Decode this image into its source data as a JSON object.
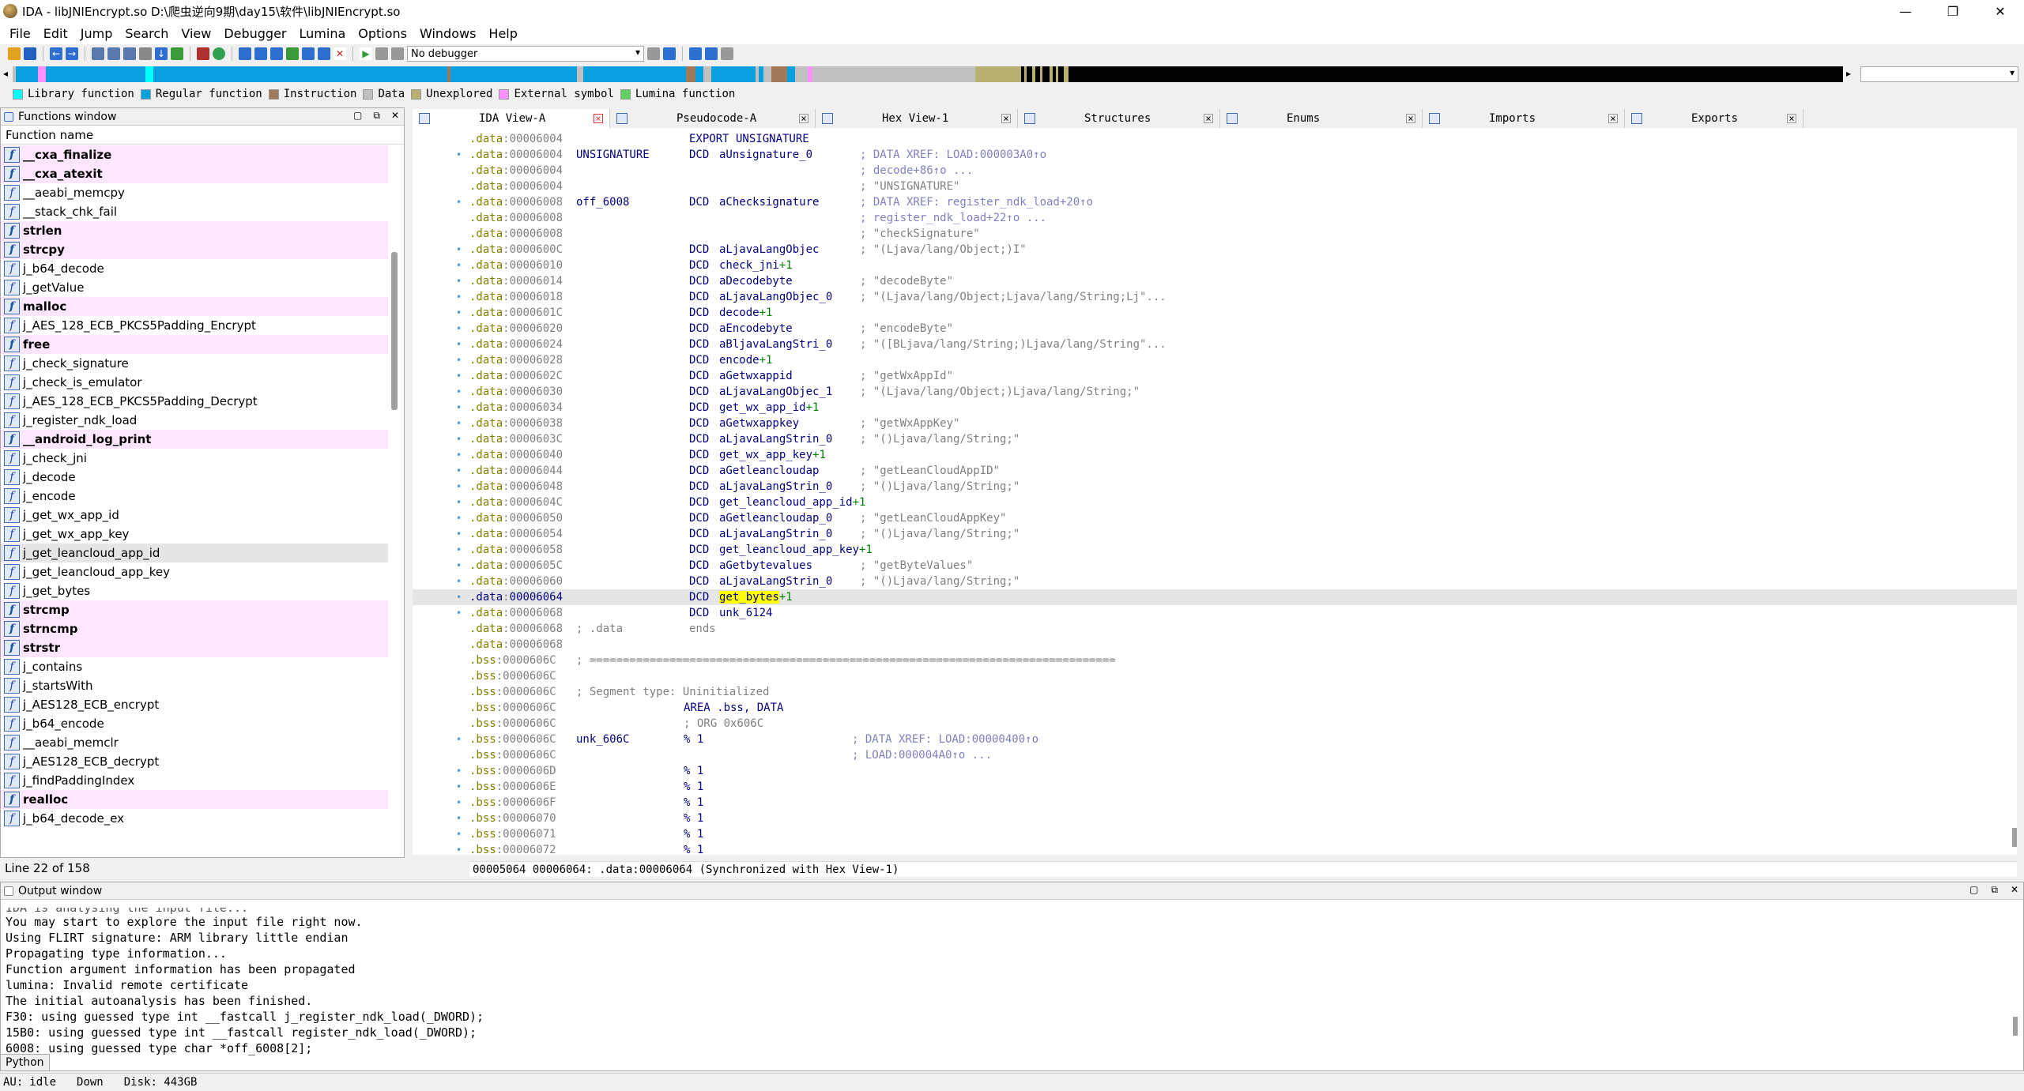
{
  "window": {
    "title": "IDA - libJNIEncrypt.so D:\\爬虫逆向9期\\day15\\软件\\libJNIEncrypt.so",
    "min_icon": "minimize-icon",
    "max_icon": "maximize-icon",
    "close_icon": "close-icon"
  },
  "menu": [
    "File",
    "Edit",
    "Jump",
    "Search",
    "View",
    "Debugger",
    "Lumina",
    "Options",
    "Windows",
    "Help"
  ],
  "toolbar": {
    "debugger_label": "No debugger"
  },
  "legend": [
    {
      "label": "Library function",
      "color": "#00ffff"
    },
    {
      "label": "Regular function",
      "color": "#0aa0e0"
    },
    {
      "label": "Instruction",
      "color": "#a0785a"
    },
    {
      "label": "Data",
      "color": "#c0c0c0"
    },
    {
      "label": "Unexplored",
      "color": "#b8b070"
    },
    {
      "label": "External symbol",
      "color": "#ff90ff"
    },
    {
      "label": "Lumina function",
      "color": "#60d060"
    }
  ],
  "functions_window": {
    "title": "Functions window",
    "column": "Function name",
    "items": [
      {
        "name": "__cxa_finalize",
        "lib": true
      },
      {
        "name": "__cxa_atexit",
        "lib": true
      },
      {
        "name": "__aeabi_memcpy",
        "lib": false
      },
      {
        "name": "__stack_chk_fail",
        "lib": false
      },
      {
        "name": "strlen",
        "lib": true
      },
      {
        "name": "strcpy",
        "lib": true
      },
      {
        "name": "j_b64_decode",
        "lib": false
      },
      {
        "name": "j_getValue",
        "lib": false
      },
      {
        "name": "malloc",
        "lib": true
      },
      {
        "name": "j_AES_128_ECB_PKCS5Padding_Encrypt",
        "lib": false
      },
      {
        "name": "free",
        "lib": true
      },
      {
        "name": "j_check_signature",
        "lib": false
      },
      {
        "name": "j_check_is_emulator",
        "lib": false
      },
      {
        "name": "j_AES_128_ECB_PKCS5Padding_Decrypt",
        "lib": false
      },
      {
        "name": "j_register_ndk_load",
        "lib": false
      },
      {
        "name": "__android_log_print",
        "lib": true
      },
      {
        "name": "j_check_jni",
        "lib": false
      },
      {
        "name": "j_decode",
        "lib": false
      },
      {
        "name": "j_encode",
        "lib": false
      },
      {
        "name": "j_get_wx_app_id",
        "lib": false
      },
      {
        "name": "j_get_wx_app_key",
        "lib": false
      },
      {
        "name": "j_get_leancloud_app_id",
        "lib": false,
        "selected": true
      },
      {
        "name": "j_get_leancloud_app_key",
        "lib": false
      },
      {
        "name": "j_get_bytes",
        "lib": false
      },
      {
        "name": "strcmp",
        "lib": true
      },
      {
        "name": "strncmp",
        "lib": true
      },
      {
        "name": "strstr",
        "lib": true
      },
      {
        "name": "j_contains",
        "lib": false
      },
      {
        "name": "j_startsWith",
        "lib": false
      },
      {
        "name": "j_AES128_ECB_encrypt",
        "lib": false
      },
      {
        "name": "j_b64_encode",
        "lib": false
      },
      {
        "name": "__aeabi_memclr",
        "lib": false
      },
      {
        "name": "j_AES128_ECB_decrypt",
        "lib": false
      },
      {
        "name": "j_findPaddingIndex",
        "lib": false
      },
      {
        "name": "realloc",
        "lib": true
      },
      {
        "name": "j_b64_decode_ex",
        "lib": false
      }
    ],
    "status": "Line 22 of 158"
  },
  "tabs": [
    {
      "label": "IDA View-A",
      "active": true
    },
    {
      "label": "Pseudocode-A",
      "active": false
    },
    {
      "label": "Hex View-1",
      "active": false
    },
    {
      "label": "Structures",
      "active": false
    },
    {
      "label": "Enums",
      "active": false
    },
    {
      "label": "Imports",
      "active": false
    },
    {
      "label": "Exports",
      "active": false
    }
  ],
  "disasm": [
    {
      "seg": ".data",
      "addr": "00006004",
      "dot": false,
      "label": "",
      "mn": "",
      "op": "EXPORT UNSIGNATURE",
      "cm": ""
    },
    {
      "seg": ".data",
      "addr": "00006004",
      "dot": true,
      "label": "UNSIGNATURE",
      "mn": "DCD",
      "op": "aUnsignature_0",
      "cm": "; DATA XREF: LOAD:000003A0↑o"
    },
    {
      "seg": ".data",
      "addr": "00006004",
      "dot": false,
      "label": "",
      "mn": "",
      "op": "",
      "cm": "; decode+86↑o ..."
    },
    {
      "seg": ".data",
      "addr": "00006004",
      "dot": false,
      "label": "",
      "mn": "",
      "op": "",
      "cm": "; \"UNSIGNATURE\""
    },
    {
      "seg": ".data",
      "addr": "00006008",
      "dot": true,
      "label": "off_6008",
      "mn": "DCD",
      "op": "aChecksignature",
      "cm": "; DATA XREF: register_ndk_load+20↑o"
    },
    {
      "seg": ".data",
      "addr": "00006008",
      "dot": false,
      "label": "",
      "mn": "",
      "op": "",
      "cm": "; register_ndk_load+22↑o ..."
    },
    {
      "seg": ".data",
      "addr": "00006008",
      "dot": false,
      "label": "",
      "mn": "",
      "op": "",
      "cm": "; \"checkSignature\""
    },
    {
      "seg": ".data",
      "addr": "0000600C",
      "dot": true,
      "label": "",
      "mn": "DCD",
      "op": "aLjavaLangObjec",
      "cm": "; \"(Ljava/lang/Object;)I\""
    },
    {
      "seg": ".data",
      "addr": "00006010",
      "dot": true,
      "label": "",
      "mn": "DCD",
      "op": "check_jni+1",
      "cm": ""
    },
    {
      "seg": ".data",
      "addr": "00006014",
      "dot": true,
      "label": "",
      "mn": "DCD",
      "op": "aDecodebyte",
      "cm": "; \"decodeByte\""
    },
    {
      "seg": ".data",
      "addr": "00006018",
      "dot": true,
      "label": "",
      "mn": "DCD",
      "op": "aLjavaLangObjec_0",
      "cm": "; \"(Ljava/lang/Object;Ljava/lang/String;Lj\"..."
    },
    {
      "seg": ".data",
      "addr": "0000601C",
      "dot": true,
      "label": "",
      "mn": "DCD",
      "op": "decode+1",
      "cm": ""
    },
    {
      "seg": ".data",
      "addr": "00006020",
      "dot": true,
      "label": "",
      "mn": "DCD",
      "op": "aEncodebyte",
      "cm": "; \"encodeByte\""
    },
    {
      "seg": ".data",
      "addr": "00006024",
      "dot": true,
      "label": "",
      "mn": "DCD",
      "op": "aBljavaLangStri_0",
      "cm": "; \"([BLjava/lang/String;)Ljava/lang/String\"..."
    },
    {
      "seg": ".data",
      "addr": "00006028",
      "dot": true,
      "label": "",
      "mn": "DCD",
      "op": "encode+1",
      "cm": ""
    },
    {
      "seg": ".data",
      "addr": "0000602C",
      "dot": true,
      "label": "",
      "mn": "DCD",
      "op": "aGetwxappid",
      "cm": "; \"getWxAppId\""
    },
    {
      "seg": ".data",
      "addr": "00006030",
      "dot": true,
      "label": "",
      "mn": "DCD",
      "op": "aLjavaLangObjec_1",
      "cm": "; \"(Ljava/lang/Object;)Ljava/lang/String;\""
    },
    {
      "seg": ".data",
      "addr": "00006034",
      "dot": true,
      "label": "",
      "mn": "DCD",
      "op": "get_wx_app_id+1",
      "cm": ""
    },
    {
      "seg": ".data",
      "addr": "00006038",
      "dot": true,
      "label": "",
      "mn": "DCD",
      "op": "aGetwxappkey",
      "cm": "; \"getWxAppKey\""
    },
    {
      "seg": ".data",
      "addr": "0000603C",
      "dot": true,
      "label": "",
      "mn": "DCD",
      "op": "aLjavaLangStrin_0",
      "cm": "; \"()Ljava/lang/String;\""
    },
    {
      "seg": ".data",
      "addr": "00006040",
      "dot": true,
      "label": "",
      "mn": "DCD",
      "op": "get_wx_app_key+1",
      "cm": ""
    },
    {
      "seg": ".data",
      "addr": "00006044",
      "dot": true,
      "label": "",
      "mn": "DCD",
      "op": "aGetleancloudap",
      "cm": "; \"getLeanCloudAppID\""
    },
    {
      "seg": ".data",
      "addr": "00006048",
      "dot": true,
      "label": "",
      "mn": "DCD",
      "op": "aLjavaLangStrin_0",
      "cm": "; \"()Ljava/lang/String;\""
    },
    {
      "seg": ".data",
      "addr": "0000604C",
      "dot": true,
      "label": "",
      "mn": "DCD",
      "op": "get_leancloud_app_id+1",
      "cm": ""
    },
    {
      "seg": ".data",
      "addr": "00006050",
      "dot": true,
      "label": "",
      "mn": "DCD",
      "op": "aGetleancloudap_0",
      "cm": "; \"getLeanCloudAppKey\""
    },
    {
      "seg": ".data",
      "addr": "00006054",
      "dot": true,
      "label": "",
      "mn": "DCD",
      "op": "aLjavaLangStrin_0",
      "cm": "; \"()Ljava/lang/String;\""
    },
    {
      "seg": ".data",
      "addr": "00006058",
      "dot": true,
      "label": "",
      "mn": "DCD",
      "op": "get_leancloud_app_key+1",
      "cm": ""
    },
    {
      "seg": ".data",
      "addr": "0000605C",
      "dot": true,
      "label": "",
      "mn": "DCD",
      "op": "aGetbytevalues",
      "cm": "; \"getByteValues\""
    },
    {
      "seg": ".data",
      "addr": "00006060",
      "dot": true,
      "label": "",
      "mn": "DCD",
      "op": "aLjavaLangStrin_0",
      "cm": "; \"()Ljava/lang/String;\""
    },
    {
      "seg": ".data",
      "addr": "00006064",
      "dot": true,
      "label": "",
      "mn": "DCD",
      "op": "get_bytes+1",
      "cm": "",
      "hl": true
    },
    {
      "seg": ".data",
      "addr": "00006068",
      "dot": true,
      "label": "",
      "mn": "DCD",
      "op": "unk_6124",
      "cm": ""
    },
    {
      "seg": ".data",
      "addr": "00006068",
      "dot": false,
      "label": "; .data",
      "mn": "",
      "op": "ends",
      "cm": ""
    },
    {
      "seg": ".data",
      "addr": "00006068",
      "dot": false,
      "label": "",
      "mn": "",
      "op": "",
      "cm": ""
    },
    {
      "seg": ".bss",
      "addr": "0000606C",
      "dot": false,
      "label": "; ===============================================================================",
      "mn": "",
      "op": "",
      "cm": ""
    },
    {
      "seg": ".bss",
      "addr": "0000606C",
      "dot": false,
      "label": "",
      "mn": "",
      "op": "",
      "cm": ""
    },
    {
      "seg": ".bss",
      "addr": "0000606C",
      "dot": false,
      "label": "; Segment type: Uninitialized",
      "mn": "",
      "op": "",
      "cm": ""
    },
    {
      "seg": ".bss",
      "addr": "0000606C",
      "dot": false,
      "label": "",
      "mn": "",
      "op": "AREA .bss, DATA",
      "cm": ""
    },
    {
      "seg": ".bss",
      "addr": "0000606C",
      "dot": false,
      "label": "",
      "mn": "",
      "op": "; ORG 0x606C",
      "cm": ""
    },
    {
      "seg": ".bss",
      "addr": "0000606C",
      "dot": true,
      "label": "unk_606C",
      "mn": "",
      "op": "% 1",
      "cm": "; DATA XREF: LOAD:00000400↑o"
    },
    {
      "seg": ".bss",
      "addr": "0000606C",
      "dot": false,
      "label": "",
      "mn": "",
      "op": "",
      "cm": "; LOAD:000004A0↑o ..."
    },
    {
      "seg": ".bss",
      "addr": "0000606D",
      "dot": true,
      "label": "",
      "mn": "",
      "op": "% 1",
      "cm": ""
    },
    {
      "seg": ".bss",
      "addr": "0000606E",
      "dot": true,
      "label": "",
      "mn": "",
      "op": "% 1",
      "cm": ""
    },
    {
      "seg": ".bss",
      "addr": "0000606F",
      "dot": true,
      "label": "",
      "mn": "",
      "op": "% 1",
      "cm": ""
    },
    {
      "seg": ".bss",
      "addr": "00006070",
      "dot": true,
      "label": "",
      "mn": "",
      "op": "% 1",
      "cm": ""
    },
    {
      "seg": ".bss",
      "addr": "00006071",
      "dot": true,
      "label": "",
      "mn": "",
      "op": "% 1",
      "cm": ""
    },
    {
      "seg": ".bss",
      "addr": "00006072",
      "dot": true,
      "label": "",
      "mn": "",
      "op": "% 1",
      "cm": ""
    }
  ],
  "sync_status": "00005064 00006064: .data:00006064 (Synchronized with Hex View-1)",
  "output_window": {
    "title": "Output window",
    "lines": [
      "You may start to explore the input file right now.",
      "Using FLIRT signature: ARM library little endian",
      "Propagating type information...",
      "Function argument information has been propagated",
      "lumina: Invalid remote certificate",
      "The initial autoanalysis has been finished.",
      "F30: using guessed type int __fastcall j_register_ndk_load(_DWORD);",
      "15B0: using guessed type int __fastcall register_ndk_load(_DWORD);",
      "6008: using guessed type char *off_6008[2];"
    ],
    "partial_line": "IDA is analysing the input file..."
  },
  "python_label": "Python",
  "status": {
    "au": "AU:",
    "state": "idle",
    "dir": "Down",
    "disk": "Disk: 443GB"
  }
}
